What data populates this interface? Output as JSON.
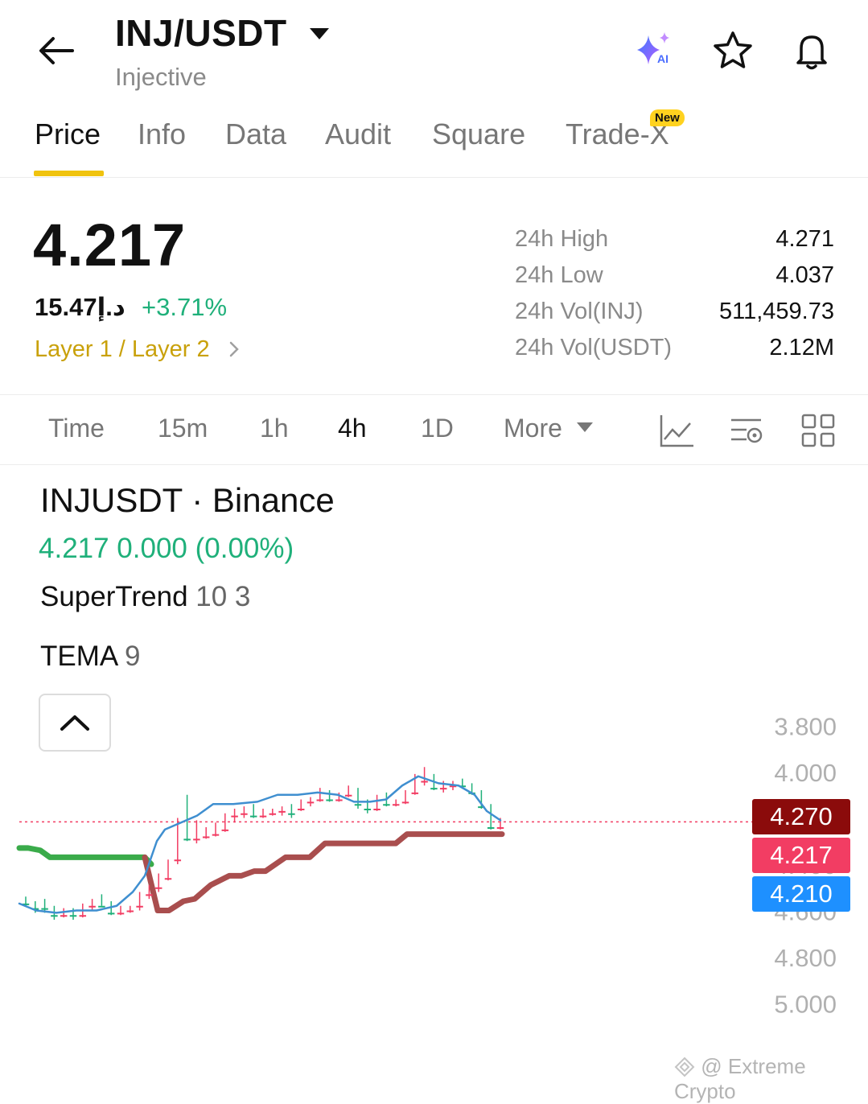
{
  "header": {
    "pair": "INJ/USDT",
    "name": "Injective"
  },
  "tabs": [
    {
      "label": "Price",
      "active": true
    },
    {
      "label": "Info"
    },
    {
      "label": "Data"
    },
    {
      "label": "Audit"
    },
    {
      "label": "Square"
    },
    {
      "label": "Trade-X",
      "badge": "New"
    }
  ],
  "price": {
    "last": "4.217",
    "fiat": "15.47د.إ",
    "change": "+3.71%",
    "category": "Layer 1 / Layer 2"
  },
  "stats": [
    {
      "label": "24h High",
      "value": "4.271"
    },
    {
      "label": "24h Low",
      "value": "4.037"
    },
    {
      "label": "24h Vol(INJ)",
      "value": "511,459.73"
    },
    {
      "label": "24h Vol(USDT)",
      "value": "2.12M"
    }
  ],
  "intervals": [
    {
      "label": "Time"
    },
    {
      "label": "15m"
    },
    {
      "label": "1h"
    },
    {
      "label": "4h",
      "active": true
    },
    {
      "label": "1D"
    },
    {
      "label": "More"
    }
  ],
  "chart": {
    "symbol": "INJUSDT · Binance",
    "quote": "4.217  0.000 (0.00%)",
    "indicators": [
      {
        "name": "SuperTrend",
        "params": " 10 3"
      },
      {
        "name": "TEMA",
        "params": " 9"
      }
    ],
    "tags": {
      "supertrend": "4.270",
      "last": "4.217",
      "tema": "4.210"
    },
    "watermark": "@ Extreme Crypto"
  },
  "colors": {
    "up": "#1fb07a",
    "down": "#f23d63",
    "accent": "#f0c30f",
    "supertrend_up": "#3aab4a",
    "supertrend_down": "#a94e4e",
    "tema": "#3f8fd0"
  },
  "chart_data": {
    "type": "candlestick",
    "y_axis": {
      "min": 3.8,
      "max": 5.0,
      "ticks": [
        "5.000",
        "4.800",
        "4.600",
        "4.400",
        "4.000",
        "3.800"
      ]
    },
    "last_price": 4.217,
    "candles": [
      [
        4.56,
        4.58,
        4.54,
        4.57
      ],
      [
        4.58,
        4.61,
        4.56,
        4.59
      ],
      [
        4.55,
        4.61,
        4.55,
        4.59
      ],
      [
        4.59,
        4.64,
        4.58,
        4.62
      ],
      [
        4.62,
        4.63,
        4.59,
        4.61
      ],
      [
        4.61,
        4.64,
        4.59,
        4.62
      ],
      [
        4.62,
        4.63,
        4.57,
        4.58
      ],
      [
        4.58,
        4.6,
        4.55,
        4.56
      ],
      [
        4.56,
        4.58,
        4.53,
        4.58
      ],
      [
        4.58,
        4.62,
        4.56,
        4.61
      ],
      [
        4.61,
        4.62,
        4.58,
        4.6
      ],
      [
        4.6,
        4.61,
        4.58,
        4.58
      ],
      [
        4.58,
        4.6,
        4.52,
        4.53
      ],
      [
        4.53,
        4.55,
        4.49,
        4.5
      ],
      [
        4.5,
        4.52,
        4.44,
        4.46
      ],
      [
        4.46,
        4.47,
        4.38,
        4.39
      ],
      [
        4.38,
        4.4,
        4.2,
        4.21
      ],
      [
        4.21,
        4.3,
        4.1,
        4.29
      ],
      [
        4.29,
        4.31,
        4.21,
        4.21
      ],
      [
        4.28,
        4.29,
        4.24,
        4.27
      ],
      [
        4.27,
        4.28,
        4.22,
        4.25
      ],
      [
        4.25,
        4.26,
        4.18,
        4.19
      ],
      [
        4.19,
        4.22,
        4.16,
        4.18
      ],
      [
        4.18,
        4.2,
        4.15,
        4.17
      ],
      [
        4.17,
        4.2,
        4.14,
        4.19
      ],
      [
        4.19,
        4.2,
        4.16,
        4.18
      ],
      [
        4.18,
        4.19,
        4.16,
        4.17
      ],
      [
        4.17,
        4.19,
        4.15,
        4.16
      ],
      [
        4.16,
        4.2,
        4.14,
        4.18
      ],
      [
        4.16,
        4.17,
        4.12,
        4.13
      ],
      [
        4.13,
        4.15,
        4.11,
        4.12
      ],
      [
        4.12,
        4.13,
        4.07,
        4.1
      ],
      [
        4.1,
        4.13,
        4.08,
        4.12
      ],
      [
        4.12,
        4.13,
        4.09,
        4.1
      ],
      [
        4.1,
        4.11,
        4.06,
        4.08
      ],
      [
        4.08,
        4.16,
        4.07,
        4.14
      ],
      [
        4.14,
        4.18,
        4.12,
        4.16
      ],
      [
        4.16,
        4.17,
        4.1,
        4.11
      ],
      [
        4.11,
        4.15,
        4.09,
        4.14
      ],
      [
        4.14,
        4.15,
        4.12,
        4.13
      ],
      [
        4.13,
        4.14,
        4.08,
        4.09
      ],
      [
        4.09,
        4.1,
        4.01,
        4.04
      ],
      [
        4.04,
        4.06,
        3.98,
        4.02
      ],
      [
        4.02,
        4.08,
        4.01,
        4.07
      ],
      [
        4.07,
        4.09,
        4.04,
        4.06
      ],
      [
        4.06,
        4.08,
        4.04,
        4.05
      ],
      [
        4.05,
        4.07,
        4.03,
        4.06
      ],
      [
        4.06,
        4.1,
        4.05,
        4.09
      ],
      [
        4.09,
        4.16,
        4.08,
        4.15
      ],
      [
        4.15,
        4.25,
        4.14,
        4.24
      ],
      [
        4.24,
        4.25,
        4.2,
        4.22
      ]
    ],
    "supertrend_up": [
      [
        24,
        4.33
      ],
      [
        35,
        4.33
      ],
      [
        50,
        4.34
      ],
      [
        62,
        4.37
      ],
      [
        180,
        4.37
      ],
      [
        188,
        4.4
      ]
    ],
    "supertrend_down": [
      [
        180,
        4.37
      ],
      [
        196,
        4.6
      ],
      [
        210,
        4.6
      ],
      [
        228,
        4.56
      ],
      [
        242,
        4.55
      ],
      [
        262,
        4.49
      ],
      [
        285,
        4.45
      ],
      [
        300,
        4.45
      ],
      [
        316,
        4.43
      ],
      [
        330,
        4.43
      ],
      [
        355,
        4.37
      ],
      [
        385,
        4.37
      ],
      [
        404,
        4.31
      ],
      [
        492,
        4.31
      ],
      [
        506,
        4.27
      ],
      [
        624,
        4.27
      ]
    ],
    "tema": [
      [
        24,
        4.57
      ],
      [
        45,
        4.6
      ],
      [
        70,
        4.61
      ],
      [
        95,
        4.6
      ],
      [
        120,
        4.6
      ],
      [
        145,
        4.58
      ],
      [
        165,
        4.52
      ],
      [
        180,
        4.45
      ],
      [
        195,
        4.3
      ],
      [
        205,
        4.25
      ],
      [
        225,
        4.22
      ],
      [
        245,
        4.19
      ],
      [
        265,
        4.14
      ],
      [
        290,
        4.14
      ],
      [
        320,
        4.13
      ],
      [
        345,
        4.1
      ],
      [
        370,
        4.1
      ],
      [
        395,
        4.09
      ],
      [
        420,
        4.1
      ],
      [
        440,
        4.13
      ],
      [
        460,
        4.13
      ],
      [
        480,
        4.12
      ],
      [
        500,
        4.06
      ],
      [
        520,
        4.02
      ],
      [
        545,
        4.05
      ],
      [
        570,
        4.06
      ],
      [
        590,
        4.1
      ],
      [
        605,
        4.17
      ],
      [
        622,
        4.21
      ]
    ]
  }
}
